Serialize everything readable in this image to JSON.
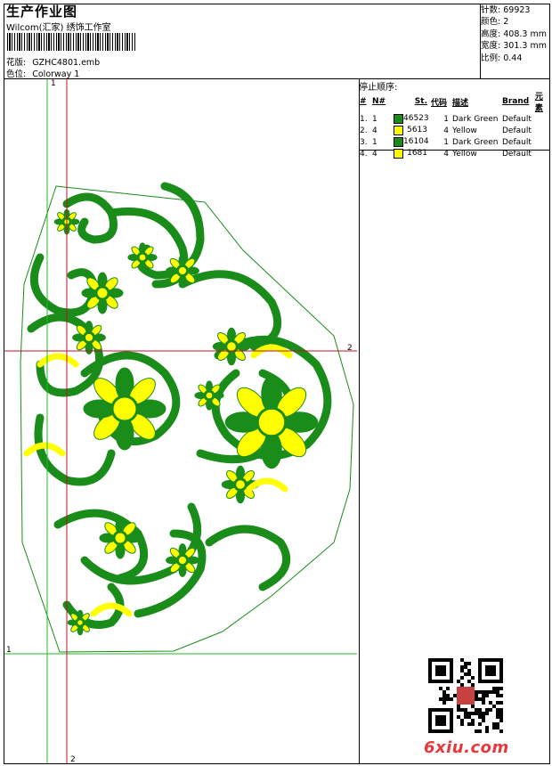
{
  "header": {
    "title": "生产作业图",
    "studio": "Wilcom(汇家) 绣饰工作室",
    "pattern": {
      "label": "花版:",
      "value": "GZHC4801.emb"
    },
    "colorway": {
      "label": "色位:",
      "value": "Colorway 1"
    }
  },
  "stats": [
    {
      "label": "针数:",
      "value": "69923"
    },
    {
      "label": "颜色:",
      "value": "2"
    },
    {
      "label": "高度:",
      "value": "408.3 mm"
    },
    {
      "label": "宽度:",
      "value": "301.3 mm"
    },
    {
      "label": "比例:",
      "value": "0.44"
    }
  ],
  "stop_sequence": {
    "title": "停止顺序:",
    "columns": {
      "idx": "#",
      "needle": "N#",
      "stitches": "St.",
      "code": "代码",
      "desc": "描述",
      "brand": "Brand",
      "element": "元素"
    },
    "rows": [
      {
        "idx": "1.",
        "needle": "1",
        "color": "#1a8c1a",
        "stitches": "46523",
        "code": "1",
        "desc": "Dark Green",
        "brand": "Default"
      },
      {
        "idx": "2.",
        "needle": "4",
        "color": "#ffff00",
        "stitches": "5613",
        "code": "4",
        "desc": "Yellow",
        "brand": "Default"
      },
      {
        "idx": "3.",
        "needle": "1",
        "color": "#1a8c1a",
        "stitches": "16104",
        "code": "1",
        "desc": "Dark Green",
        "brand": "Default"
      },
      {
        "idx": "4.",
        "needle": "4",
        "color": "#ffff00",
        "stitches": "1681",
        "code": "4",
        "desc": "Yellow",
        "brand": "Default"
      }
    ]
  },
  "guides": {
    "green_label": "1",
    "red_label": "2"
  },
  "logo": "6xiu.com",
  "colors": {
    "green": "#1a8c1a",
    "yellow": "#ffff00",
    "guide_green": "#22bb22",
    "guide_red": "#c0102a",
    "logo_red": "#e8383d"
  }
}
